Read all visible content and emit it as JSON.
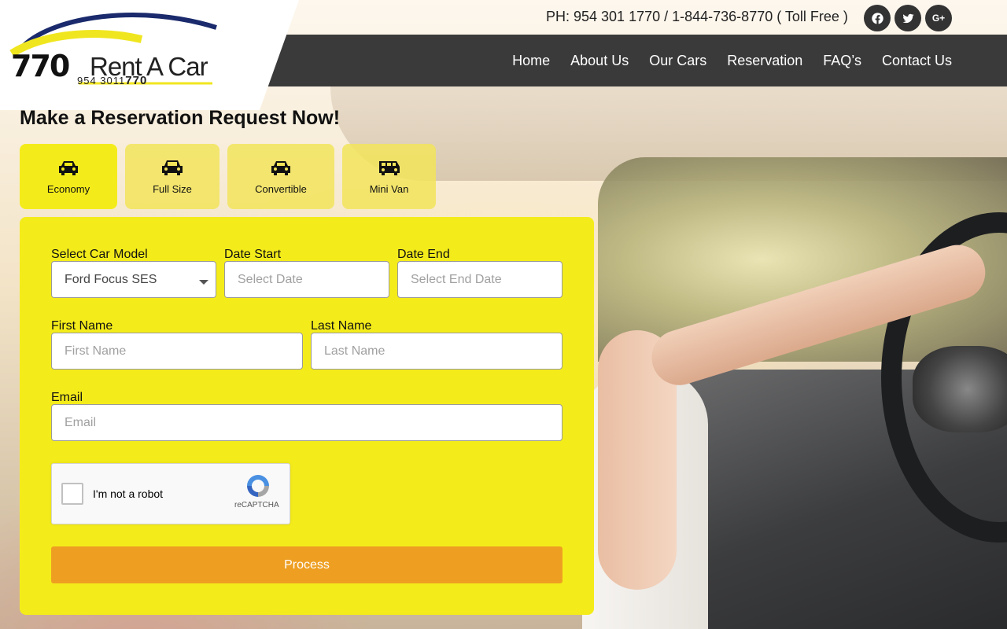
{
  "header": {
    "logo": {
      "number": "770",
      "name": "Rent A Car",
      "phone_prefix": "954 3011",
      "phone_suffix": "770"
    },
    "phone_line": "PH: 954 301 1770 / 1-844-736-8770 ( Toll Free )",
    "social": [
      {
        "icon": "facebook-icon",
        "label": "f"
      },
      {
        "icon": "twitter-icon",
        "label": "t"
      },
      {
        "icon": "google-plus-icon",
        "label": "G+"
      }
    ],
    "nav": [
      "Home",
      "About Us",
      "Our Cars",
      "Reservation",
      "FAQ’s",
      "Contact Us"
    ]
  },
  "page": {
    "heading": "Make a Reservation Request Now!"
  },
  "car_types": [
    {
      "label": "Economy",
      "icon": "car-icon",
      "active": true
    },
    {
      "label": "Full Size",
      "icon": "car-icon",
      "active": false
    },
    {
      "label": "Convertible",
      "icon": "car-icon",
      "active": false
    },
    {
      "label": "Mini Van",
      "icon": "van-icon",
      "active": false
    }
  ],
  "form": {
    "car_model": {
      "label": "Select Car Model",
      "value": "Ford Focus SES"
    },
    "date_start": {
      "label": "Date Start",
      "placeholder": "Select Date"
    },
    "date_end": {
      "label": "Date End",
      "placeholder": "Select End Date"
    },
    "first_name": {
      "label": "First Name",
      "placeholder": "First Name"
    },
    "last_name": {
      "label": "Last Name",
      "placeholder": "Last Name"
    },
    "email": {
      "label": "Email",
      "placeholder": "Email"
    },
    "captcha": {
      "label": "I'm not a robot",
      "brand": "reCAPTCHA"
    },
    "submit_label": "Process"
  },
  "colors": {
    "accent_yellow": "#f4ec1a",
    "button_orange": "#ee9f22",
    "nav_dark": "#3a3a3a"
  }
}
